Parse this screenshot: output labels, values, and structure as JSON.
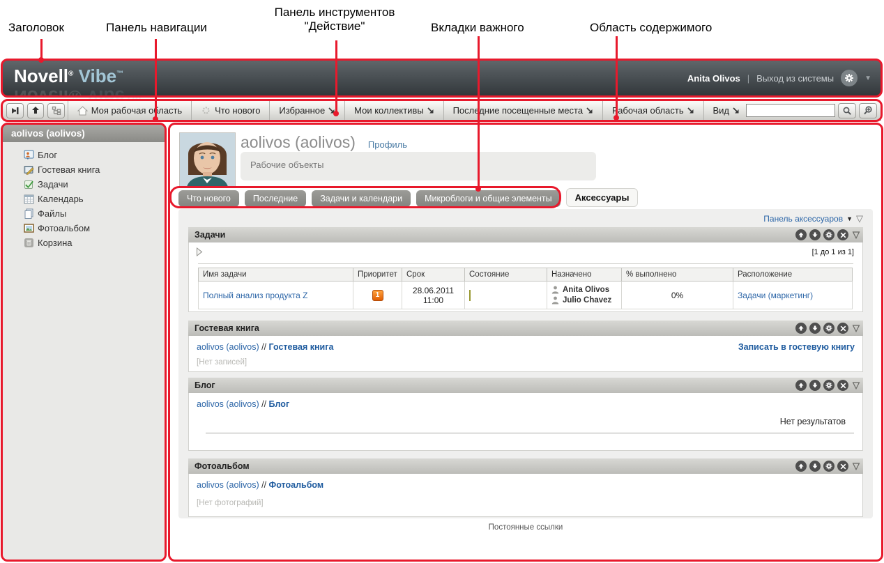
{
  "annotations": {
    "color": "#e8192c",
    "labels": {
      "header": "Заголовок",
      "nav": "Панель навигации",
      "tools_line1": "Панель инструментов",
      "tools_line2": "\"Действие\"",
      "tabs": "Вкладки важного",
      "content": "Область содержимого"
    }
  },
  "header": {
    "logo": {
      "name": "Novell",
      "reg": "®",
      "product": "Vibe",
      "tm": "™"
    },
    "user_name": "Anita Olivos",
    "separator": "|",
    "logout_label": "Выход из системы"
  },
  "toolbar": {
    "items": [
      {
        "label": "Моя рабочая область",
        "icon": "home-icon"
      },
      {
        "label": "Что нового",
        "icon": "whats-new-icon"
      },
      {
        "label": "Избранное",
        "icon": "dropdown-arrow-icon"
      },
      {
        "label": "Мои коллективы",
        "icon": "dropdown-arrow-icon"
      },
      {
        "label": "Последние посещенные места",
        "icon": "dropdown-arrow-icon"
      },
      {
        "label": "Рабочая область",
        "icon": "dropdown-arrow-icon"
      },
      {
        "label": "Вид",
        "icon": "dropdown-arrow-icon"
      }
    ],
    "search_value": "",
    "search_placeholder": ""
  },
  "sidebar": {
    "title": "aolivos (aolivos)",
    "items": [
      {
        "label": "Блог",
        "icon": "blog-icon"
      },
      {
        "label": "Гостевая книга",
        "icon": "guestbook-icon"
      },
      {
        "label": "Задачи",
        "icon": "tasks-icon"
      },
      {
        "label": "Календарь",
        "icon": "calendar-icon"
      },
      {
        "label": "Файлы",
        "icon": "files-icon"
      },
      {
        "label": "Фотоальбом",
        "icon": "photo-album-icon"
      },
      {
        "label": "Корзина",
        "icon": "trash-icon"
      }
    ]
  },
  "content": {
    "title": "aolivos (aolivos)",
    "profile_link": "Профиль",
    "workspace_objects": "Рабочие объекты",
    "tabs": [
      {
        "label": "Что нового",
        "active": false
      },
      {
        "label": "Последние",
        "active": false
      },
      {
        "label": "Задачи и календари",
        "active": false
      },
      {
        "label": "Микроблоги и общие элементы",
        "active": false
      },
      {
        "label": "Аксессуары",
        "active": true
      }
    ],
    "accessory_panel_label": "Панель аксессуаров",
    "tasks": {
      "title": "Задачи",
      "pagination": "[1 до 1 из 1]",
      "table": {
        "headers": [
          "Имя задачи",
          "Приоритет",
          "Срок",
          "Состояние",
          "Назначено",
          "% выполнено",
          "Расположение"
        ],
        "row": {
          "name": "Полный анализ продукта Z",
          "priority": "1",
          "due": "28.06.2011 11:00",
          "assignees": [
            "Anita Olivos",
            "Julio Chavez"
          ],
          "percent": "0%",
          "location": "Задачи (маркетинг)"
        }
      }
    },
    "guestbook": {
      "title": "Гостевая книга",
      "crumb_workspace": "aolivos (aolivos)",
      "crumb_sep": "//",
      "crumb_page": "Гостевая книга",
      "action": "Записать в гостевую книгу",
      "empty": "[Нет записей]"
    },
    "blog": {
      "title": "Блог",
      "crumb_workspace": "aolivos (aolivos)",
      "crumb_sep": "//",
      "crumb_page": "Блог",
      "empty": "Нет результатов"
    },
    "photo_album": {
      "title": "Фотоальбом",
      "crumb_workspace": "aolivos (aolivos)",
      "crumb_sep": "//",
      "crumb_page": "Фотоальбом",
      "empty": "[Нет фотографий]"
    },
    "footer_link": "Постоянные ссылки"
  }
}
